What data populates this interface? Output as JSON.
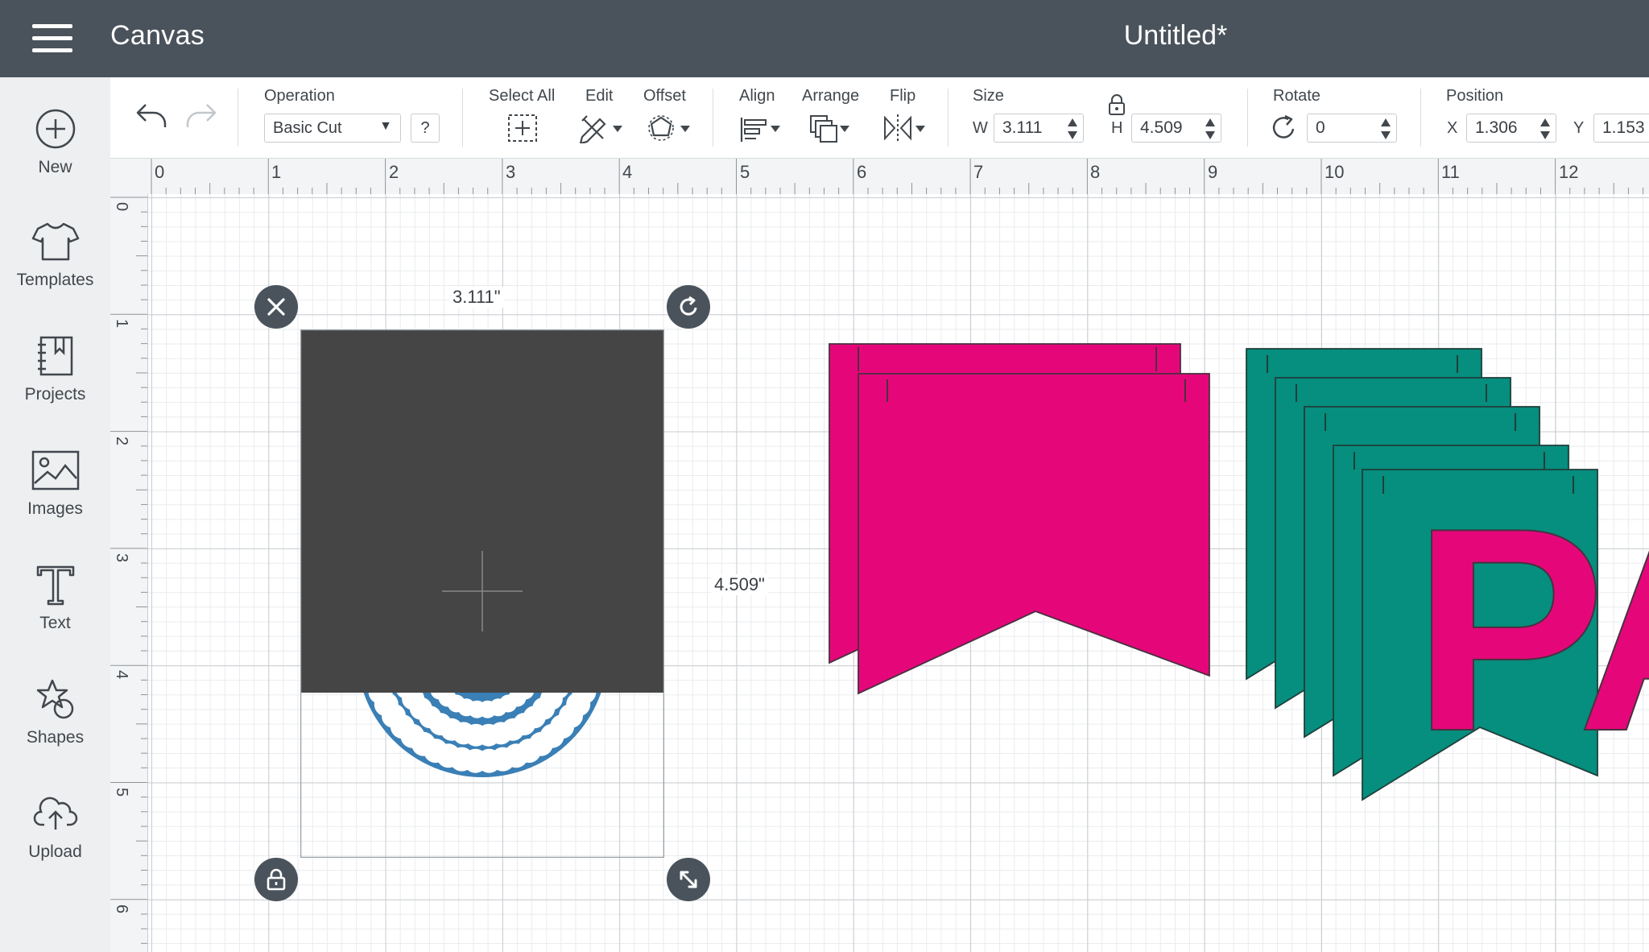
{
  "header": {
    "app_title": "Canvas",
    "document_title": "Untitled*",
    "background_color": "#4a535c"
  },
  "sidebar": {
    "items": [
      {
        "label": "New",
        "icon": "plus-circle-icon"
      },
      {
        "label": "Templates",
        "icon": "tshirt-icon"
      },
      {
        "label": "Projects",
        "icon": "notebook-icon"
      },
      {
        "label": "Images",
        "icon": "image-icon"
      },
      {
        "label": "Text",
        "icon": "text-t-icon"
      },
      {
        "label": "Shapes",
        "icon": "shapes-icon"
      },
      {
        "label": "Upload",
        "icon": "cloud-upload-icon"
      }
    ]
  },
  "toolbar": {
    "operation_label": "Operation",
    "operation_value": "Basic Cut",
    "help_label": "?",
    "select_all_label": "Select All",
    "edit_label": "Edit",
    "offset_label": "Offset",
    "align_label": "Align",
    "arrange_label": "Arrange",
    "flip_label": "Flip",
    "size_label": "Size",
    "width_prefix": "W",
    "width_value": "3.111",
    "height_prefix": "H",
    "height_value": "4.509",
    "rotate_label": "Rotate",
    "rotate_value": "0",
    "position_label": "Position",
    "x_prefix": "X",
    "x_value": "1.306",
    "y_prefix": "Y",
    "y_value": "1.153"
  },
  "rulers": {
    "horizontal": [
      "0",
      "1",
      "2",
      "3",
      "4",
      "5",
      "6",
      "7",
      "8",
      "9",
      "10",
      "11",
      "12"
    ],
    "vertical": [
      "0",
      "1",
      "2",
      "3",
      "4",
      "5",
      "6"
    ]
  },
  "canvas": {
    "width_label": "3.111\"",
    "height_label": "4.509\"",
    "colors": {
      "dark_rect": "#454545",
      "doily": "#3a7fb5",
      "pink_banner": "#e5077a",
      "teal_banner": "#068e7e"
    },
    "banner_letters": [
      "P",
      "A"
    ]
  }
}
